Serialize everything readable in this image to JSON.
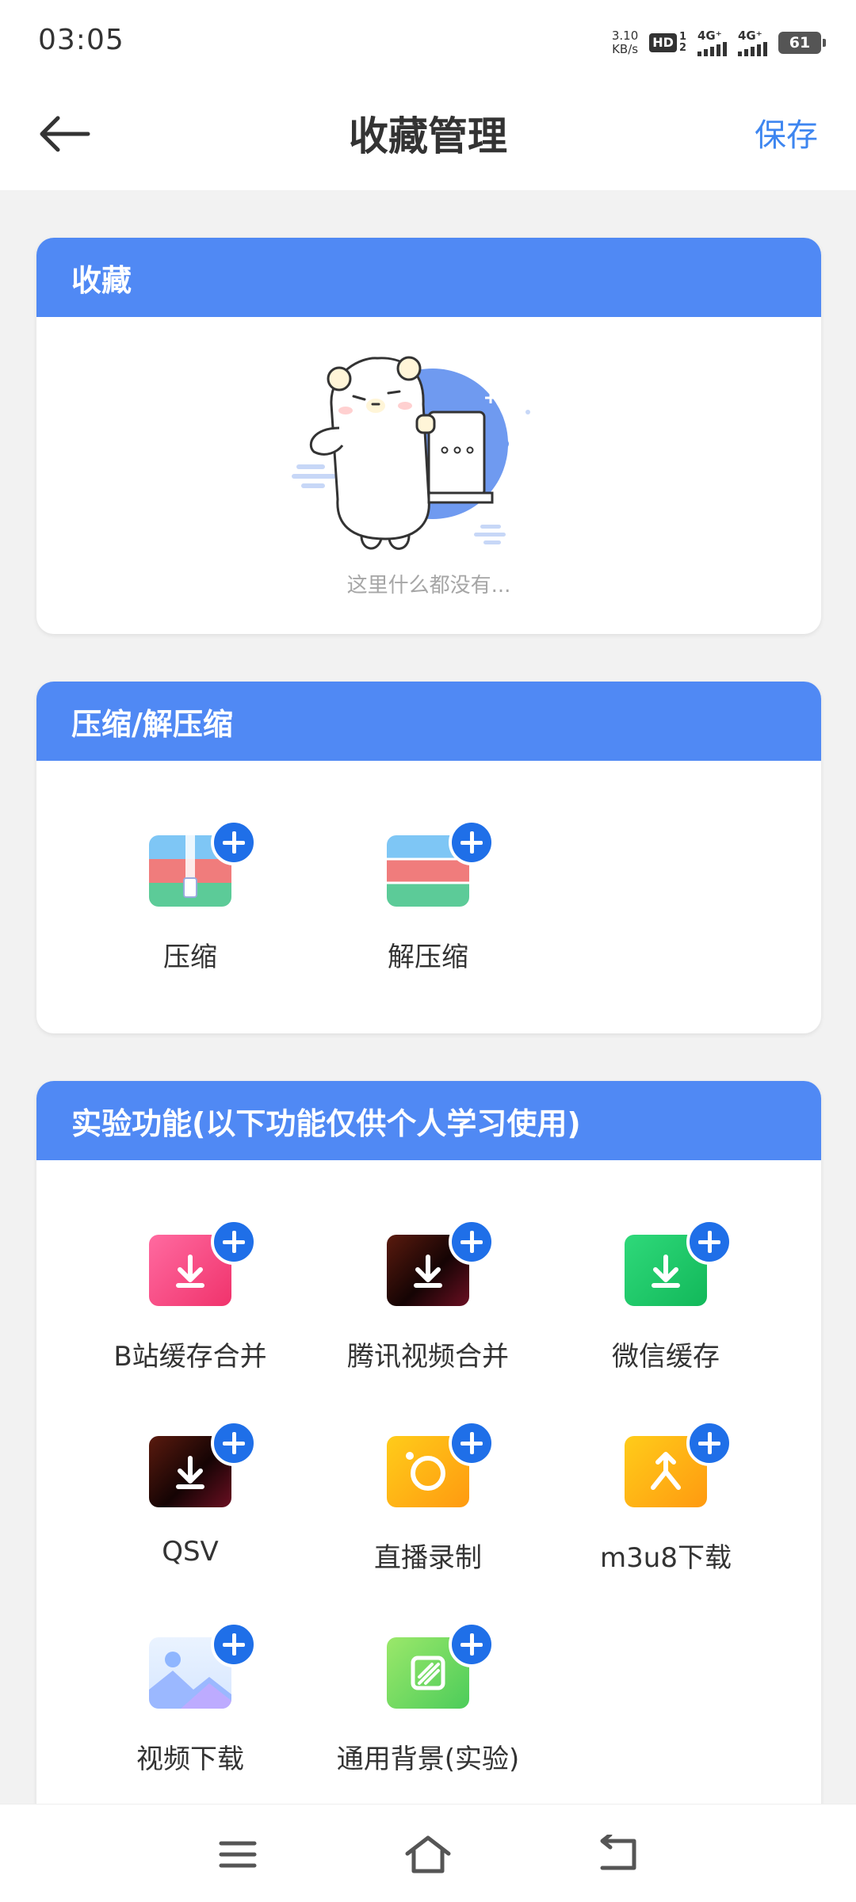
{
  "status_bar": {
    "time": "03:05",
    "net_speed_value": "3.10",
    "net_speed_unit": "KB/s",
    "hd": "HD",
    "hd_sub_top": "1",
    "hd_sub_bottom": "2",
    "signal_1": "4G⁺",
    "signal_2": "4G⁺",
    "battery": "61"
  },
  "header": {
    "back_icon": "arrow-left-icon",
    "title": "收藏管理",
    "save_label": "保存"
  },
  "favorites": {
    "title": "收藏",
    "empty_text": "这里什么都没有..."
  },
  "compression": {
    "title": "压缩/解压缩",
    "tools": [
      {
        "label": "压缩",
        "icon": "zip-archive-icon"
      },
      {
        "label": "解压缩",
        "icon": "unzip-archive-icon"
      }
    ]
  },
  "experimental": {
    "title": "实验功能(以下功能仅供个人学习使用)",
    "tools": [
      {
        "label": "B站缓存合并",
        "icon": "download-pink-icon"
      },
      {
        "label": "腾讯视频合并",
        "icon": "download-dark-icon"
      },
      {
        "label": "微信缓存",
        "icon": "download-green-icon"
      },
      {
        "label": "QSV",
        "icon": "download-dark-icon"
      },
      {
        "label": "直播录制",
        "icon": "record-circle-icon"
      },
      {
        "label": "m3u8下载",
        "icon": "merge-arrow-icon"
      },
      {
        "label": "视频下载",
        "icon": "image-landscape-icon"
      },
      {
        "label": "通用背景(实验)",
        "icon": "background-pattern-icon"
      }
    ]
  },
  "colors": {
    "accent": "#5089f4",
    "save": "#3e86f0",
    "plus_badge": "#1f6fe8"
  },
  "nav_bar": {
    "menu_icon": "menu-icon",
    "home_icon": "home-icon",
    "back_icon": "back-return-icon"
  }
}
